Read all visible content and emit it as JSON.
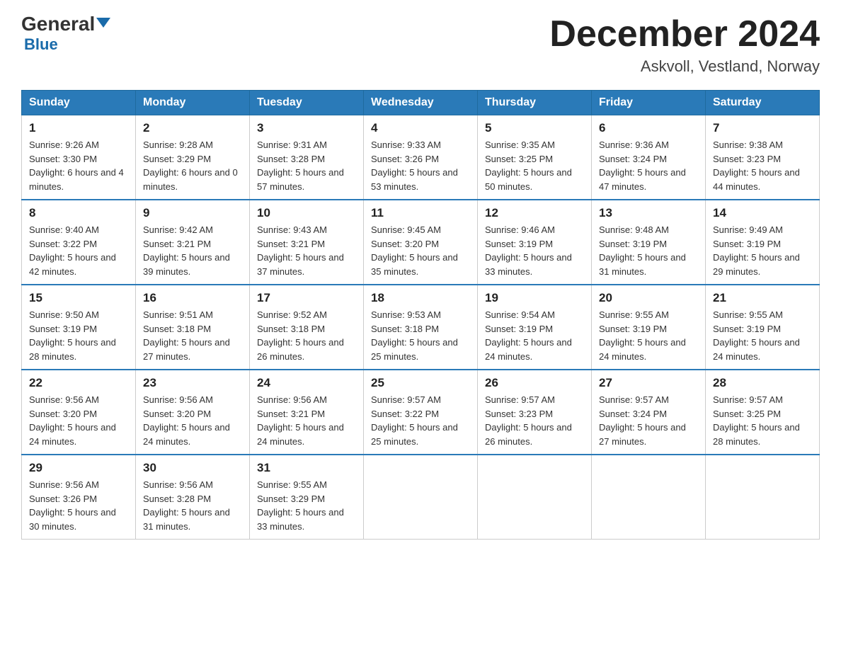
{
  "header": {
    "logo_general": "General",
    "logo_blue": "Blue",
    "month_title": "December 2024",
    "location": "Askvoll, Vestland, Norway"
  },
  "weekdays": [
    "Sunday",
    "Monday",
    "Tuesday",
    "Wednesday",
    "Thursday",
    "Friday",
    "Saturday"
  ],
  "weeks": [
    [
      {
        "day": "1",
        "sunrise": "9:26 AM",
        "sunset": "3:30 PM",
        "daylight": "6 hours and 4 minutes."
      },
      {
        "day": "2",
        "sunrise": "9:28 AM",
        "sunset": "3:29 PM",
        "daylight": "6 hours and 0 minutes."
      },
      {
        "day": "3",
        "sunrise": "9:31 AM",
        "sunset": "3:28 PM",
        "daylight": "5 hours and 57 minutes."
      },
      {
        "day": "4",
        "sunrise": "9:33 AM",
        "sunset": "3:26 PM",
        "daylight": "5 hours and 53 minutes."
      },
      {
        "day": "5",
        "sunrise": "9:35 AM",
        "sunset": "3:25 PM",
        "daylight": "5 hours and 50 minutes."
      },
      {
        "day": "6",
        "sunrise": "9:36 AM",
        "sunset": "3:24 PM",
        "daylight": "5 hours and 47 minutes."
      },
      {
        "day": "7",
        "sunrise": "9:38 AM",
        "sunset": "3:23 PM",
        "daylight": "5 hours and 44 minutes."
      }
    ],
    [
      {
        "day": "8",
        "sunrise": "9:40 AM",
        "sunset": "3:22 PM",
        "daylight": "5 hours and 42 minutes."
      },
      {
        "day": "9",
        "sunrise": "9:42 AM",
        "sunset": "3:21 PM",
        "daylight": "5 hours and 39 minutes."
      },
      {
        "day": "10",
        "sunrise": "9:43 AM",
        "sunset": "3:21 PM",
        "daylight": "5 hours and 37 minutes."
      },
      {
        "day": "11",
        "sunrise": "9:45 AM",
        "sunset": "3:20 PM",
        "daylight": "5 hours and 35 minutes."
      },
      {
        "day": "12",
        "sunrise": "9:46 AM",
        "sunset": "3:19 PM",
        "daylight": "5 hours and 33 minutes."
      },
      {
        "day": "13",
        "sunrise": "9:48 AM",
        "sunset": "3:19 PM",
        "daylight": "5 hours and 31 minutes."
      },
      {
        "day": "14",
        "sunrise": "9:49 AM",
        "sunset": "3:19 PM",
        "daylight": "5 hours and 29 minutes."
      }
    ],
    [
      {
        "day": "15",
        "sunrise": "9:50 AM",
        "sunset": "3:19 PM",
        "daylight": "5 hours and 28 minutes."
      },
      {
        "day": "16",
        "sunrise": "9:51 AM",
        "sunset": "3:18 PM",
        "daylight": "5 hours and 27 minutes."
      },
      {
        "day": "17",
        "sunrise": "9:52 AM",
        "sunset": "3:18 PM",
        "daylight": "5 hours and 26 minutes."
      },
      {
        "day": "18",
        "sunrise": "9:53 AM",
        "sunset": "3:18 PM",
        "daylight": "5 hours and 25 minutes."
      },
      {
        "day": "19",
        "sunrise": "9:54 AM",
        "sunset": "3:19 PM",
        "daylight": "5 hours and 24 minutes."
      },
      {
        "day": "20",
        "sunrise": "9:55 AM",
        "sunset": "3:19 PM",
        "daylight": "5 hours and 24 minutes."
      },
      {
        "day": "21",
        "sunrise": "9:55 AM",
        "sunset": "3:19 PM",
        "daylight": "5 hours and 24 minutes."
      }
    ],
    [
      {
        "day": "22",
        "sunrise": "9:56 AM",
        "sunset": "3:20 PM",
        "daylight": "5 hours and 24 minutes."
      },
      {
        "day": "23",
        "sunrise": "9:56 AM",
        "sunset": "3:20 PM",
        "daylight": "5 hours and 24 minutes."
      },
      {
        "day": "24",
        "sunrise": "9:56 AM",
        "sunset": "3:21 PM",
        "daylight": "5 hours and 24 minutes."
      },
      {
        "day": "25",
        "sunrise": "9:57 AM",
        "sunset": "3:22 PM",
        "daylight": "5 hours and 25 minutes."
      },
      {
        "day": "26",
        "sunrise": "9:57 AM",
        "sunset": "3:23 PM",
        "daylight": "5 hours and 26 minutes."
      },
      {
        "day": "27",
        "sunrise": "9:57 AM",
        "sunset": "3:24 PM",
        "daylight": "5 hours and 27 minutes."
      },
      {
        "day": "28",
        "sunrise": "9:57 AM",
        "sunset": "3:25 PM",
        "daylight": "5 hours and 28 minutes."
      }
    ],
    [
      {
        "day": "29",
        "sunrise": "9:56 AM",
        "sunset": "3:26 PM",
        "daylight": "5 hours and 30 minutes."
      },
      {
        "day": "30",
        "sunrise": "9:56 AM",
        "sunset": "3:28 PM",
        "daylight": "5 hours and 31 minutes."
      },
      {
        "day": "31",
        "sunrise": "9:55 AM",
        "sunset": "3:29 PM",
        "daylight": "5 hours and 33 minutes."
      },
      null,
      null,
      null,
      null
    ]
  ]
}
